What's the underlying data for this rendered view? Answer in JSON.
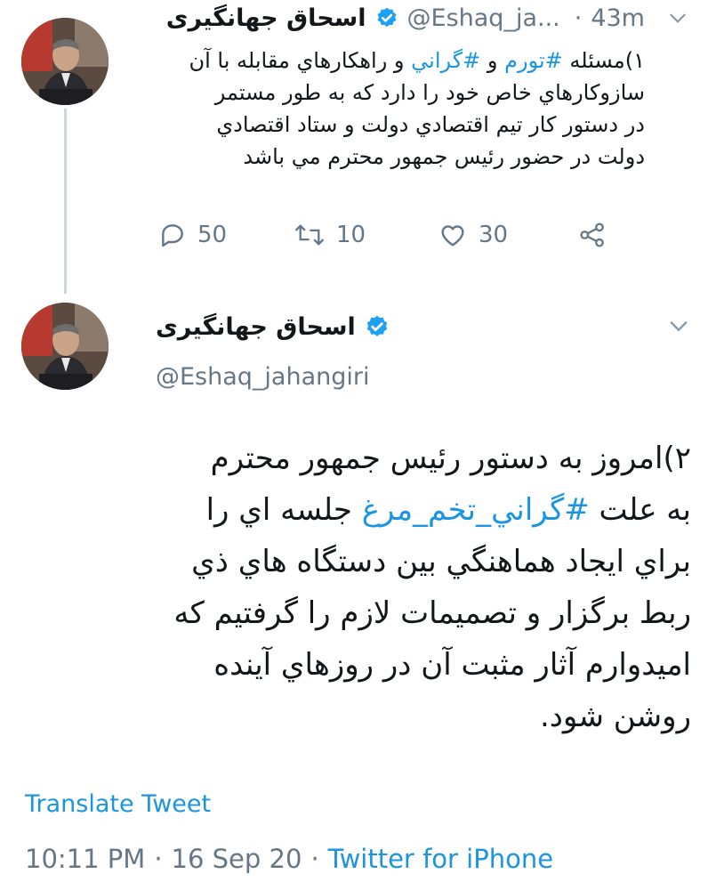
{
  "tweet1": {
    "name": "اسحاق جهانگیری",
    "handle": "@Eshaq_ja...",
    "time_sep": "·",
    "time": "43m",
    "body": {
      "prefix": "١)مسئله ",
      "tag1": "#تورم",
      "mid1": " و ",
      "tag2": "#گراني",
      "line1_rest": " و راهكارهاي مقابله با آن",
      "line2": "سازوكارهاي خاص خود را دارد كه به طور مستمر",
      "line3": "در دستور كار تيم اقتصادي دولت و ستاد اقتصادي",
      "line4": "دولت در حضور رئيس جمهور محترم مي باشد"
    },
    "actions": {
      "replies": "50",
      "retweets": "10",
      "likes": "30"
    }
  },
  "tweet2": {
    "name": "اسحاق جهانگیری",
    "handle": "@Eshaq_jahangiri",
    "body": {
      "line1": "٢)امروز به دستور رئيس جمهور محترم",
      "line2_pre": "به علت ",
      "tag": "#گراني_تخم_مرغ",
      "line2_post": " جلسه اي را",
      "line3": "براي ايجاد هماهنگي بين دستگاه هاي ذي",
      "line4": "ربط برگزار و تصميمات لازم را گرفتيم كه",
      "line5": "اميدوارم آثار مثبت آن در روزهاي آينده",
      "line6": "روشن شود."
    },
    "translate": "Translate Tweet",
    "meta": {
      "time": "10:11 PM",
      "sep1": "·",
      "date": "16 Sep 20",
      "sep2": "·",
      "source": "Twitter for iPhone"
    }
  },
  "colors": {
    "accent": "#1b95e0",
    "muted": "#657786",
    "verified": "#1da1f2"
  },
  "icons": [
    "reply-icon",
    "retweet-icon",
    "like-icon",
    "share-icon",
    "chevron-down-icon",
    "verified-badge-icon"
  ]
}
